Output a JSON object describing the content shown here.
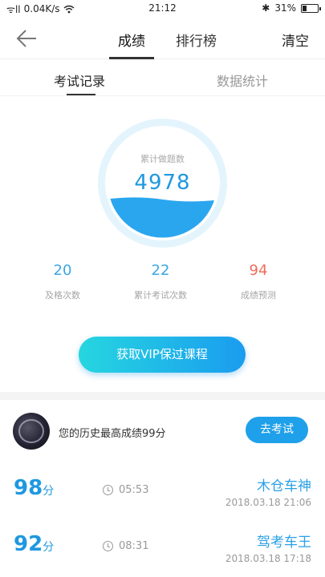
{
  "status_bar": {
    "network": "ᯤll",
    "speed": "0.04K/s",
    "time": "21:12",
    "bluetooth": "✱",
    "battery_percent": "31%"
  },
  "nav": {
    "tabs": [
      {
        "label": "成绩",
        "active": true
      },
      {
        "label": "排行榜",
        "active": false
      }
    ],
    "clear_label": "清空"
  },
  "sub_tabs": [
    {
      "label": "考试记录",
      "active": true
    },
    {
      "label": "数据统计",
      "active": false
    }
  ],
  "gauge": {
    "label": "累计做题数",
    "value": "4978",
    "fill_fraction": 0.35,
    "accent": "#2aa6ef",
    "ring_color": "#e3f4fd"
  },
  "stats": [
    {
      "value": "20",
      "label": "及格次数",
      "color": "#3aa7e4"
    },
    {
      "value": "22",
      "label": "累计考试次数",
      "color": "#3aa7e4"
    },
    {
      "value": "94",
      "label": "成绩预测",
      "color": "#ef6b5a"
    }
  ],
  "vip_button": "获取VIP保过课程",
  "best": {
    "text": "您的历史最高成绩99分",
    "button": "去考试"
  },
  "records": [
    {
      "score": "98",
      "unit": "分",
      "duration": "05:53",
      "title": "木仓车神",
      "date": "2018.03.18  21:06"
    },
    {
      "score": "92",
      "unit": "分",
      "duration": "08:31",
      "title": "驾考车王",
      "date": "2018.03.18  17:18"
    }
  ]
}
